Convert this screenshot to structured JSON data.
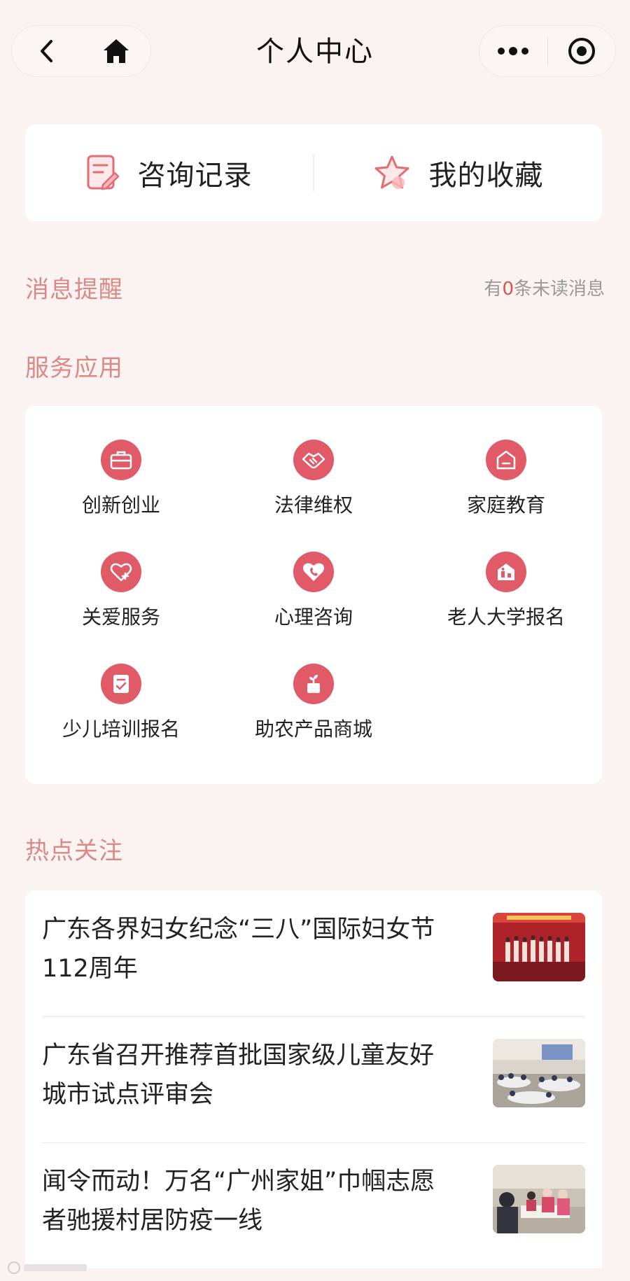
{
  "nav": {
    "title": "个人中心"
  },
  "quick": [
    {
      "label": "咨询记录",
      "icon": "consult-record-icon"
    },
    {
      "label": "我的收藏",
      "icon": "star-icon"
    }
  ],
  "messages": {
    "title": "消息提醒",
    "unread_prefix": "有",
    "unread_count": "0",
    "unread_suffix": "条未读消息"
  },
  "services": {
    "title": "服务应用",
    "items": [
      {
        "label": "创新创业",
        "icon": "briefcase-icon"
      },
      {
        "label": "法律维权",
        "icon": "handshake-icon"
      },
      {
        "label": "家庭教育",
        "icon": "home-icon"
      },
      {
        "label": "关爱服务",
        "icon": "heart-plus-icon"
      },
      {
        "label": "心理咨询",
        "icon": "heart-phone-icon"
      },
      {
        "label": "老人大学报名",
        "icon": "building-icon"
      },
      {
        "label": "少儿培训报名",
        "icon": "checklist-icon"
      },
      {
        "label": "助农产品商城",
        "icon": "plant-icon"
      }
    ]
  },
  "hot": {
    "title": "热点关注",
    "items": [
      {
        "title": "广东各界妇女纪念“三八”国际妇女节112周年"
      },
      {
        "title": "广东省召开推荐首批国家级儿童友好城市试点评审会"
      },
      {
        "title": "闻令而动！万名“广州家姐”巾帼志愿者驰援村居防疫一线"
      }
    ]
  },
  "colors": {
    "accent": "#e05a67",
    "section": "#d98a86",
    "background": "#faf3f2"
  }
}
